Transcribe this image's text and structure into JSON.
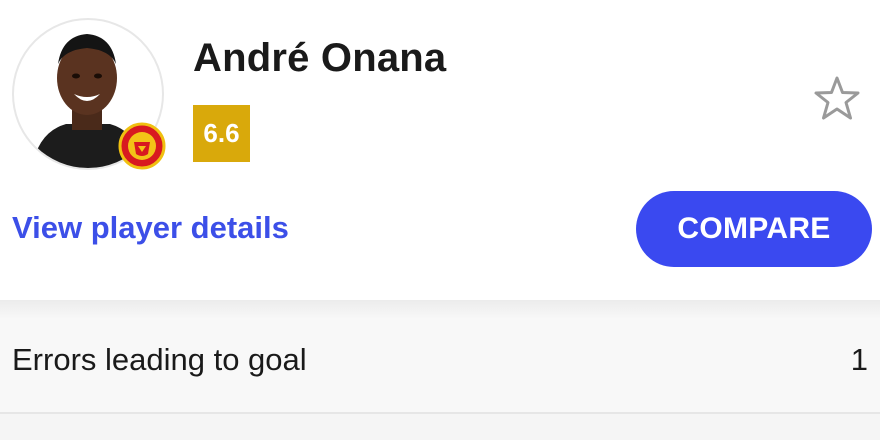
{
  "player": {
    "name": "André Onana",
    "rating": "6.6",
    "rating_color": "#d9a90b",
    "avatar_icon": "player-photo",
    "club_badge_icon": "manchester-united-crest"
  },
  "actions": {
    "favorite_icon": "star-outline-icon",
    "details_link": "View player details",
    "compare_button": "COMPARE",
    "accent_color": "#3a49f0"
  },
  "stats": [
    {
      "label": "Errors leading to goal",
      "value": "1"
    }
  ]
}
